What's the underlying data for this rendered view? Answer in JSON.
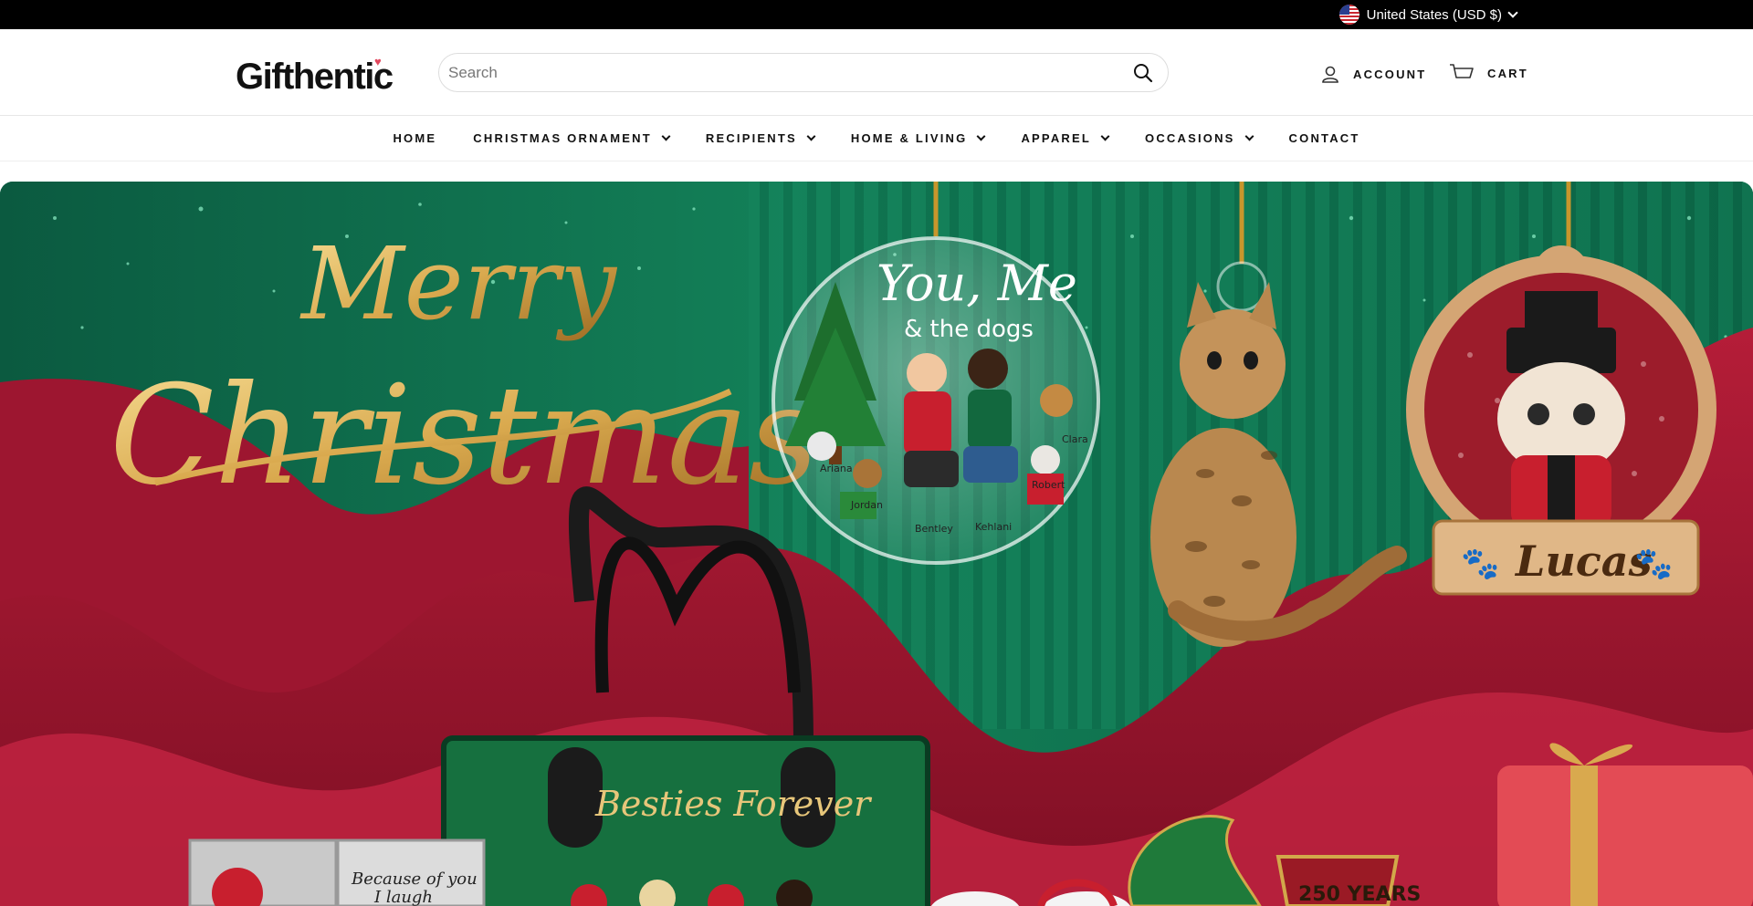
{
  "topbar": {
    "currency_label": "United States (USD $)"
  },
  "header": {
    "logo_text": "Gifthentic",
    "search_placeholder": "Search",
    "account_label": "ACCOUNT",
    "cart_label": "CART"
  },
  "nav": {
    "items": [
      {
        "label": "HOME",
        "dropdown": false
      },
      {
        "label": "CHRISTMAS ORNAMENT",
        "dropdown": true
      },
      {
        "label": "RECIPIENTS",
        "dropdown": true
      },
      {
        "label": "HOME & LIVING",
        "dropdown": true
      },
      {
        "label": "APPAREL",
        "dropdown": true
      },
      {
        "label": "OCCASIONS",
        "dropdown": true
      },
      {
        "label": "CONTACT",
        "dropdown": false
      }
    ]
  },
  "hero": {
    "headline_1": "Merry",
    "headline_2": "Christmas",
    "ornament_title_1": "You, Me",
    "ornament_title_2": "& the dogs",
    "ornament_names": [
      "Ariana",
      "Jordan",
      "Bentley",
      "Kehlani",
      "Robert",
      "Clara"
    ],
    "cat_ornament_name": "Lucas",
    "bag_text": "Besties Forever",
    "tumbler_text_1": "Because of you",
    "tumbler_text_2": "I laugh",
    "plaque_text": "250 YEARS",
    "colors": {
      "green": "#0f6b4d",
      "red": "#a3142f",
      "gold": "#d9a94e"
    }
  }
}
